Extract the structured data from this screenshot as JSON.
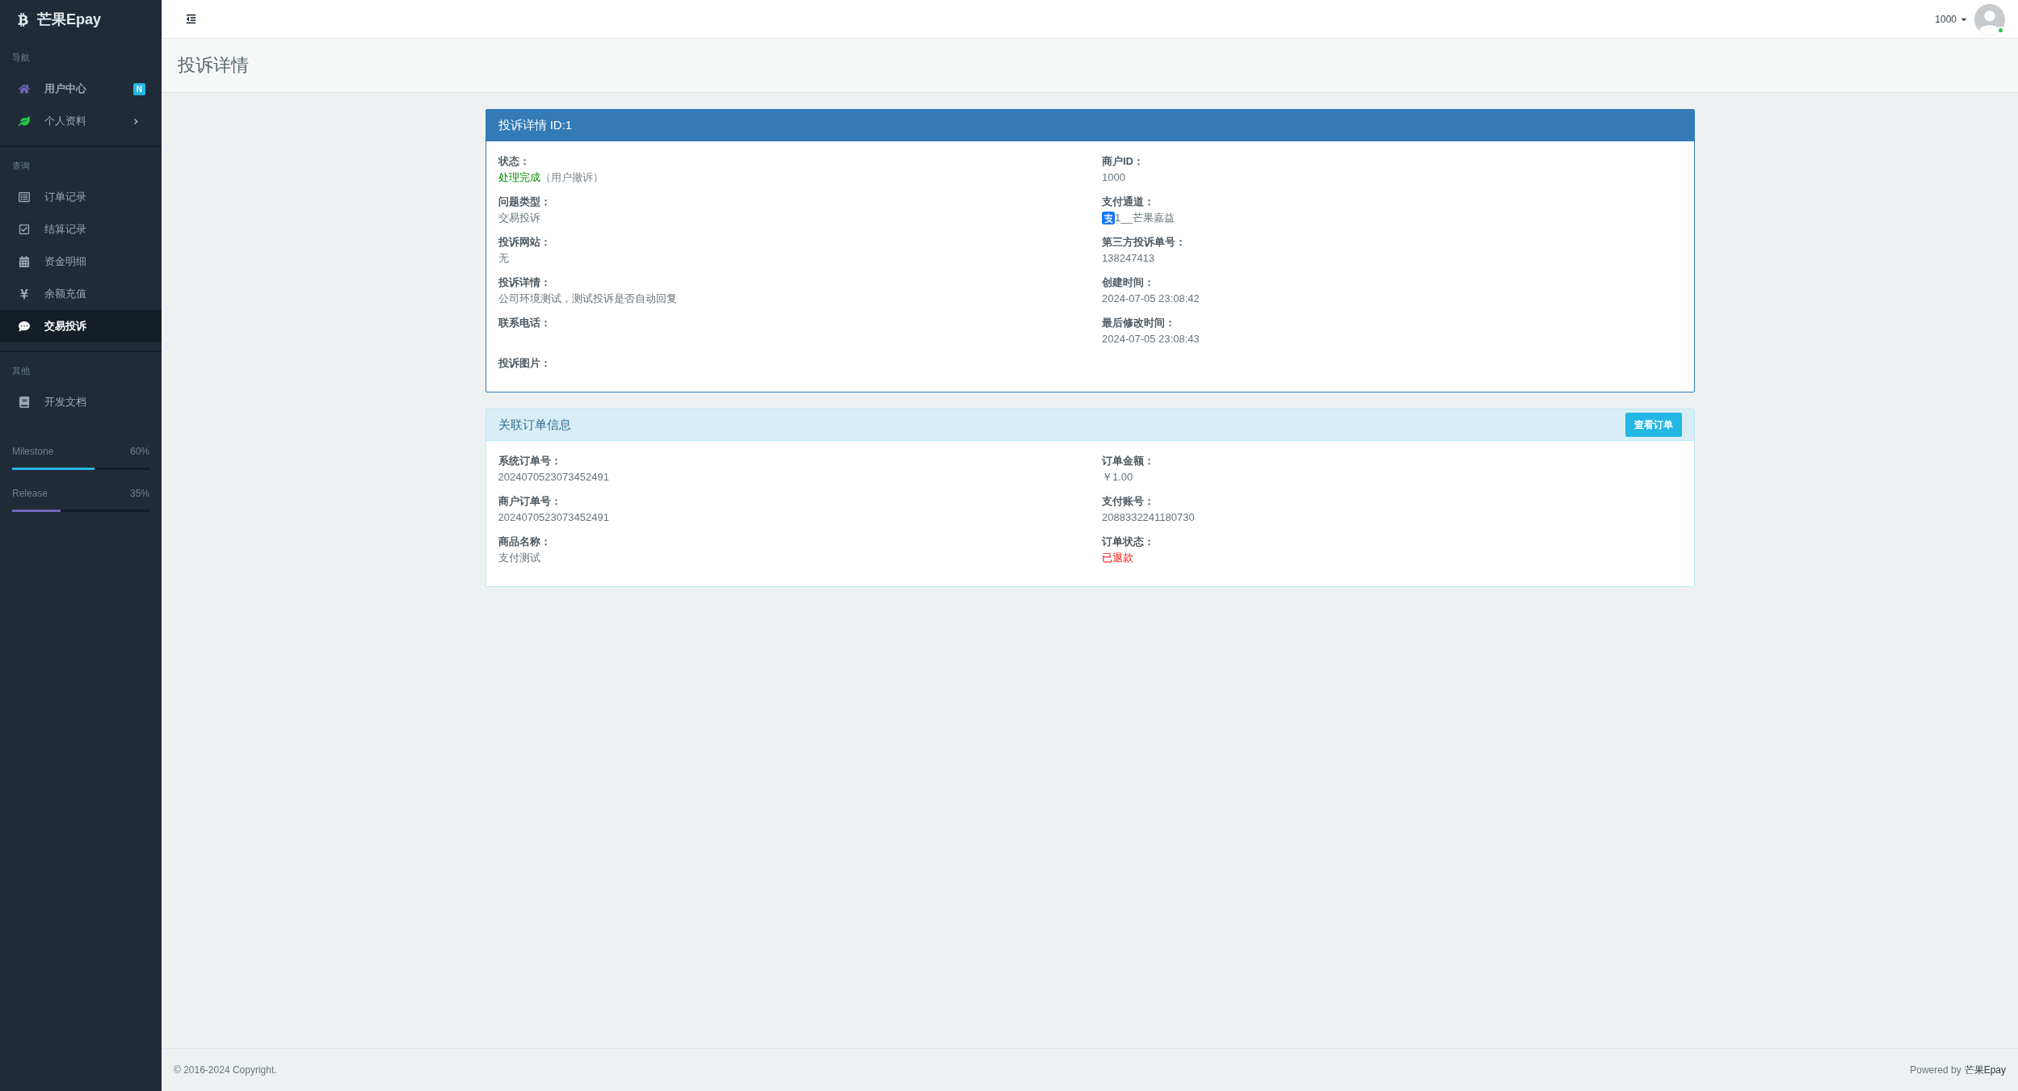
{
  "sidebar": {
    "logo": "芒果Epay",
    "sections": [
      {
        "title": "导航",
        "items": [
          {
            "label": "用户中心",
            "kind": "link",
            "badge": "N",
            "emphasized": true,
            "selected": false
          },
          {
            "label": "个人资料",
            "kind": "submenu",
            "emphasized": false,
            "selected": false
          }
        ]
      },
      {
        "title": "查询",
        "items": [
          {
            "label": "订单记录",
            "kind": "link",
            "emphasized": false,
            "selected": false
          },
          {
            "label": "结算记录",
            "kind": "link",
            "emphasized": false,
            "selected": false
          },
          {
            "label": "资金明细",
            "kind": "link",
            "emphasized": false,
            "selected": false
          },
          {
            "label": "余额充值",
            "kind": "link",
            "emphasized": false,
            "selected": false
          },
          {
            "label": "交易投诉",
            "kind": "link",
            "emphasized": true,
            "selected": true
          }
        ]
      },
      {
        "title": "其他",
        "items": [
          {
            "label": "开发文档",
            "kind": "link",
            "emphasized": false,
            "selected": false
          }
        ]
      }
    ],
    "progress": [
      {
        "label": "Milestone",
        "reading": "60%",
        "level": 0.6,
        "color": "#23b7e5"
      },
      {
        "label": "Release",
        "reading": "35%",
        "level": 0.35,
        "color": "#7266ba"
      }
    ]
  },
  "topbar": {
    "user": "1000",
    "online": true
  },
  "page_title": "投诉详情",
  "complaint": {
    "title": "投诉详情 ID:1",
    "columns": [
      {
        "fields": [
          {
            "label": "状态：",
            "kind": "success",
            "value": "处理完成",
            "note": "（用户撤诉）"
          },
          {
            "label": "问题类型：",
            "kind": "text",
            "value": "交易投诉"
          },
          {
            "label": "投诉网站：",
            "kind": "text",
            "value": "无"
          },
          {
            "label": "投诉详情：",
            "kind": "text",
            "value": "公司环境测试，测试投诉是否自动回复"
          },
          {
            "label": "联系电话：",
            "kind": "text"
          },
          {
            "label": "投诉图片：",
            "kind": "images"
          }
        ]
      },
      {
        "fields": [
          {
            "label": "商户ID：",
            "kind": "text",
            "value": "1000"
          },
          {
            "label": "支付通道：",
            "kind": "channel",
            "value": "1__芒果嘉益"
          },
          {
            "label": "第三方投诉单号：",
            "kind": "text",
            "value": "138247413"
          },
          {
            "label": "创建时间：",
            "kind": "text",
            "value": "2024-07-05 23:08:42"
          },
          {
            "label": "最后修改时间：",
            "kind": "text",
            "value": "2024-07-05 23:08:43"
          }
        ]
      }
    ]
  },
  "order": {
    "title": "关联订单信息",
    "button": "查看订单",
    "columns": [
      {
        "fields": [
          {
            "label": "系统订单号：",
            "kind": "text",
            "value": "2024070523073452491"
          },
          {
            "label": "商户订单号：",
            "kind": "text",
            "value": "2024070523073452491"
          },
          {
            "label": "商品名称：",
            "kind": "text",
            "value": "支付测试"
          }
        ]
      },
      {
        "fields": [
          {
            "label": "订单金额：",
            "kind": "text",
            "value": "￥1.00"
          },
          {
            "label": "支付账号：",
            "kind": "text",
            "value": "2088332241180730"
          },
          {
            "label": "订单状态：",
            "kind": "danger",
            "value": "已退款"
          }
        ]
      }
    ]
  },
  "footer": {
    "copyright": "© 2016-2024 Copyright.",
    "powered_label": "Powered by",
    "powered_brand": "芒果Epay"
  }
}
